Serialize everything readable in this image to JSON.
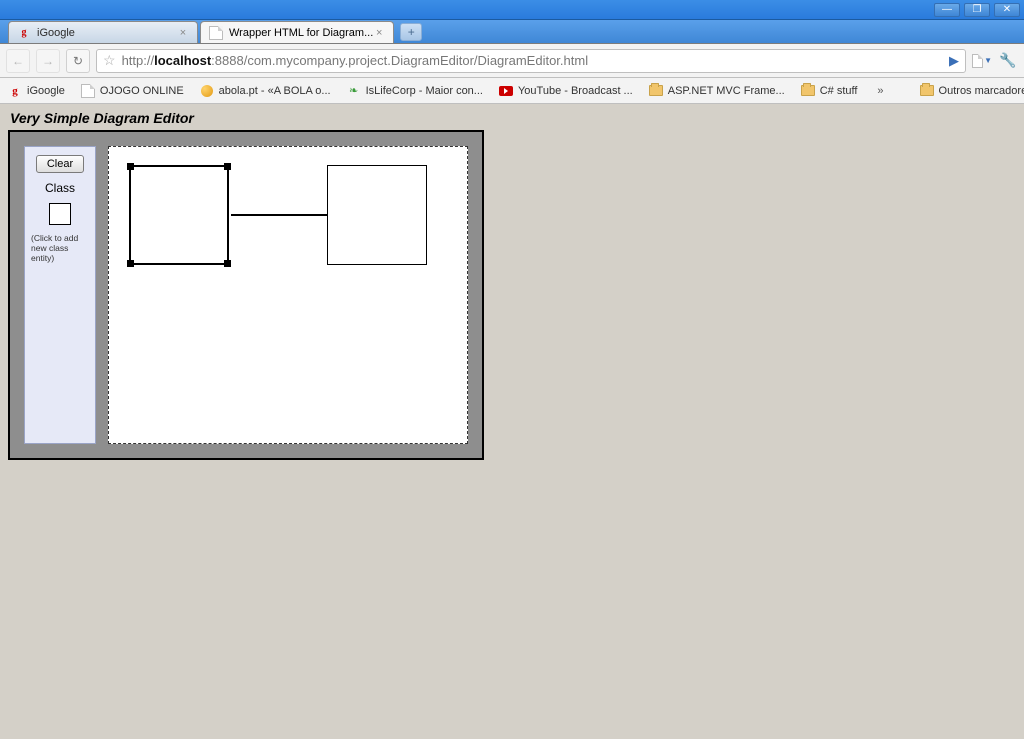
{
  "window": {
    "min": "—",
    "max": "❐",
    "close": "✕"
  },
  "tabs": [
    {
      "title": "iGoogle",
      "active": false,
      "fav": "g"
    },
    {
      "title": "Wrapper HTML for Diagram...",
      "active": true,
      "fav": "file"
    }
  ],
  "newtab": "+",
  "nav": {
    "back": "←",
    "forward": "→",
    "reload": "↻"
  },
  "address": {
    "scheme": "http://",
    "host": "localhost",
    "rest": ":8888/com.mycompany.project.DiagramEditor/DiagramEditor.html",
    "star": "☆",
    "go": "▶"
  },
  "menus": {
    "page": "📄▾",
    "wrench": "🔧"
  },
  "bookmarks": [
    {
      "icon": "g",
      "label": "iGoogle"
    },
    {
      "icon": "file",
      "label": "OJOGO ONLINE"
    },
    {
      "icon": "globe",
      "label": "abola.pt - «A BOLA o..."
    },
    {
      "icon": "leaf",
      "label": "IsLifeCorp - Maior con..."
    },
    {
      "icon": "yt",
      "label": "YouTube - Broadcast ..."
    },
    {
      "icon": "folder",
      "label": "ASP.NET MVC Frame..."
    },
    {
      "icon": "folder",
      "label": "C# stuff"
    }
  ],
  "bookmarks_more": "»",
  "bookmarks_other": "Outros marcadores",
  "app": {
    "title": "Very Simple Diagram Editor",
    "palette": {
      "clear": "Clear",
      "class_label": "Class",
      "hint": "(Click to add new class entity)"
    }
  }
}
